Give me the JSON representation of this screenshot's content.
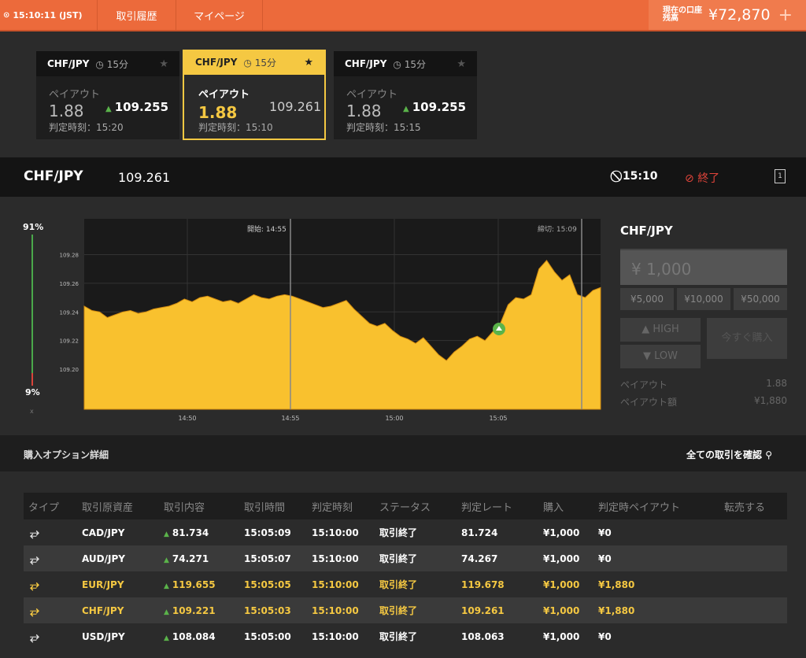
{
  "topbar": {
    "time": "15:10:11 (JST)",
    "history": "取引履歴",
    "mypage": "マイページ",
    "balance_label": "現在の口座残高",
    "balance": "¥72,870",
    "plus": "+"
  },
  "tiles": [
    {
      "pair": "CHF/JPY",
      "duration": "15分",
      "payout_label": "ペイアウト",
      "payout": "1.88",
      "rate": "109.255",
      "time_label": "判定時刻：15:20"
    },
    {
      "pair": "CHF/JPY",
      "duration": "15分",
      "payout_label": "ペイアウト",
      "payout": "1.88",
      "rate": "109.261",
      "time_label": "判定時刻：15:10"
    },
    {
      "pair": "CHF/JPY",
      "duration": "15分",
      "payout_label": "ペイアウト",
      "payout": "1.88",
      "rate": "109.255",
      "time_label": "判定時刻：15:15"
    }
  ],
  "asset": {
    "symbol": "CHF/JPY",
    "price": "109.261",
    "expiry": "15:10",
    "status": "終了",
    "box": "1"
  },
  "gauge": {
    "high_pct": "91%",
    "low_pct": "9%",
    "high_value": 91,
    "x": "x"
  },
  "chart_data": {
    "type": "area",
    "start_label": "開始: 14:55",
    "end_label": "締切: 15:09",
    "y_ticks": [
      "109.28",
      "109.26",
      "109.24",
      "109.22",
      "109.20"
    ],
    "x_ticks": [
      "14:50",
      "14:55",
      "15:00",
      "15:05"
    ],
    "ylim": [
      109.172,
      109.305
    ],
    "points": [
      109.244,
      109.241,
      109.24,
      109.236,
      109.238,
      109.24,
      109.241,
      109.239,
      109.24,
      109.242,
      109.243,
      109.244,
      109.246,
      109.249,
      109.247,
      109.25,
      109.251,
      109.249,
      109.247,
      109.248,
      109.246,
      109.249,
      109.252,
      109.25,
      109.249,
      109.251,
      109.252,
      109.251,
      109.249,
      109.247,
      109.245,
      109.243,
      109.244,
      109.246,
      109.248,
      109.242,
      109.237,
      109.232,
      109.23,
      109.232,
      109.227,
      109.223,
      109.221,
      109.218,
      109.222,
      109.216,
      109.21,
      109.206,
      109.212,
      109.216,
      109.221,
      109.223,
      109.22,
      109.226,
      109.232,
      109.245,
      109.25,
      109.249,
      109.252,
      109.27,
      109.276,
      109.268,
      109.262,
      109.266,
      109.252,
      109.25,
      109.255,
      109.257
    ]
  },
  "side": {
    "symbol": "CHF/JPY",
    "amount": "¥ 1,000",
    "chips": [
      "¥5,000",
      "¥10,000",
      "¥50,000"
    ],
    "high": "HIGH",
    "low": "LOW",
    "buy": "今すぐ購入",
    "payout_label": "ペイアウト",
    "payout": "1.88",
    "payout_amount_label": "ペイアウト額",
    "payout_amount": "¥1,880"
  },
  "details": {
    "title": "購入オプション詳細",
    "view_all": "全ての取引を確認"
  },
  "table": {
    "headers": [
      "タイプ",
      "取引原資産",
      "取引内容",
      "取引時間",
      "判定時刻",
      "ステータス",
      "判定レート",
      "購入",
      "判定時ペイアウト",
      "転売する"
    ],
    "rows": [
      {
        "pair": "CAD/JPY",
        "rate": "81.734",
        "time": "15:05:09",
        "judge": "15:10:00",
        "status": "取引終了",
        "judge_rate": "81.724",
        "buy": "¥1,000",
        "payout": "¥0",
        "win": false
      },
      {
        "pair": "AUD/JPY",
        "rate": "74.271",
        "time": "15:05:07",
        "judge": "15:10:00",
        "status": "取引終了",
        "judge_rate": "74.267",
        "buy": "¥1,000",
        "payout": "¥0",
        "win": false
      },
      {
        "pair": "EUR/JPY",
        "rate": "119.655",
        "time": "15:05:05",
        "judge": "15:10:00",
        "status": "取引終了",
        "judge_rate": "119.678",
        "buy": "¥1,000",
        "payout": "¥1,880",
        "win": true
      },
      {
        "pair": "CHF/JPY",
        "rate": "109.221",
        "time": "15:05:03",
        "judge": "15:10:00",
        "status": "取引終了",
        "judge_rate": "109.261",
        "buy": "¥1,000",
        "payout": "¥1,880",
        "win": true
      },
      {
        "pair": "USD/JPY",
        "rate": "108.084",
        "time": "15:05:00",
        "judge": "15:10:00",
        "status": "取引終了",
        "judge_rate": "108.063",
        "buy": "¥1,000",
        "payout": "¥0",
        "win": false
      }
    ]
  }
}
